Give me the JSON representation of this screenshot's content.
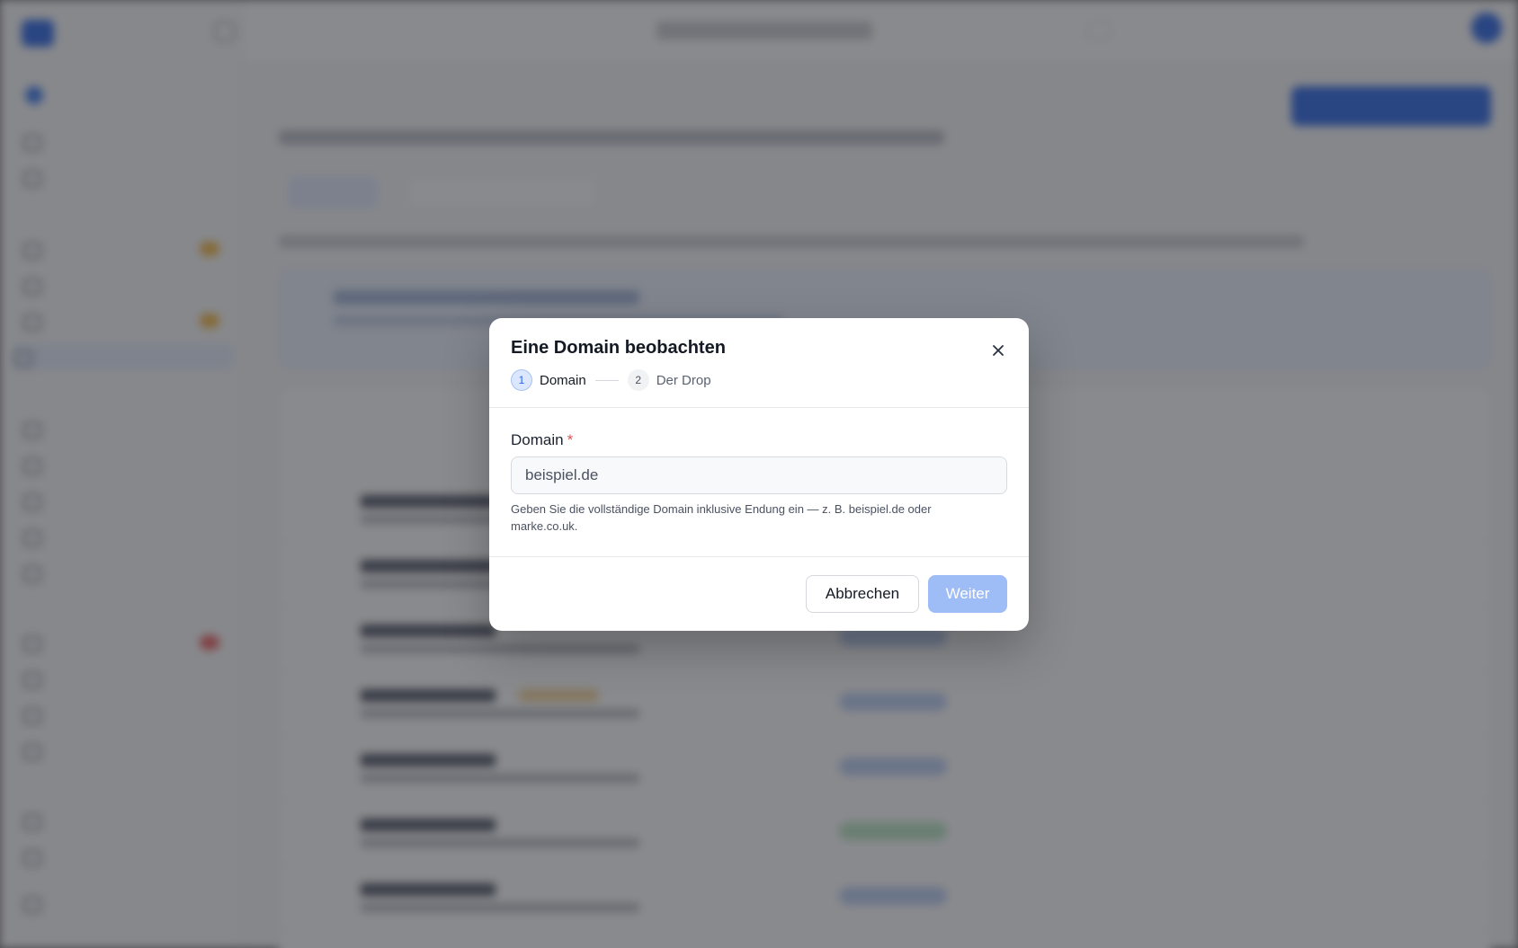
{
  "modal": {
    "title": "Eine Domain beobachten",
    "steps": [
      {
        "number": "1",
        "label": "Domain",
        "state": "active"
      },
      {
        "number": "2",
        "label": "Der Drop",
        "state": "inactive"
      }
    ],
    "field": {
      "label": "Domain",
      "required_mark": "*",
      "placeholder": "beispiel.de",
      "value": "",
      "hint": "Geben Sie die vollständige Domain inklusive Endung ein — z. B. beispiel.de oder marke.co.uk."
    },
    "buttons": {
      "cancel": "Abbrechen",
      "next": "Weiter"
    }
  },
  "colors": {
    "accent": "#2b66e6",
    "required": "#e05252",
    "next_disabled": "#9ebcf5"
  },
  "icons": [
    "close-icon"
  ]
}
